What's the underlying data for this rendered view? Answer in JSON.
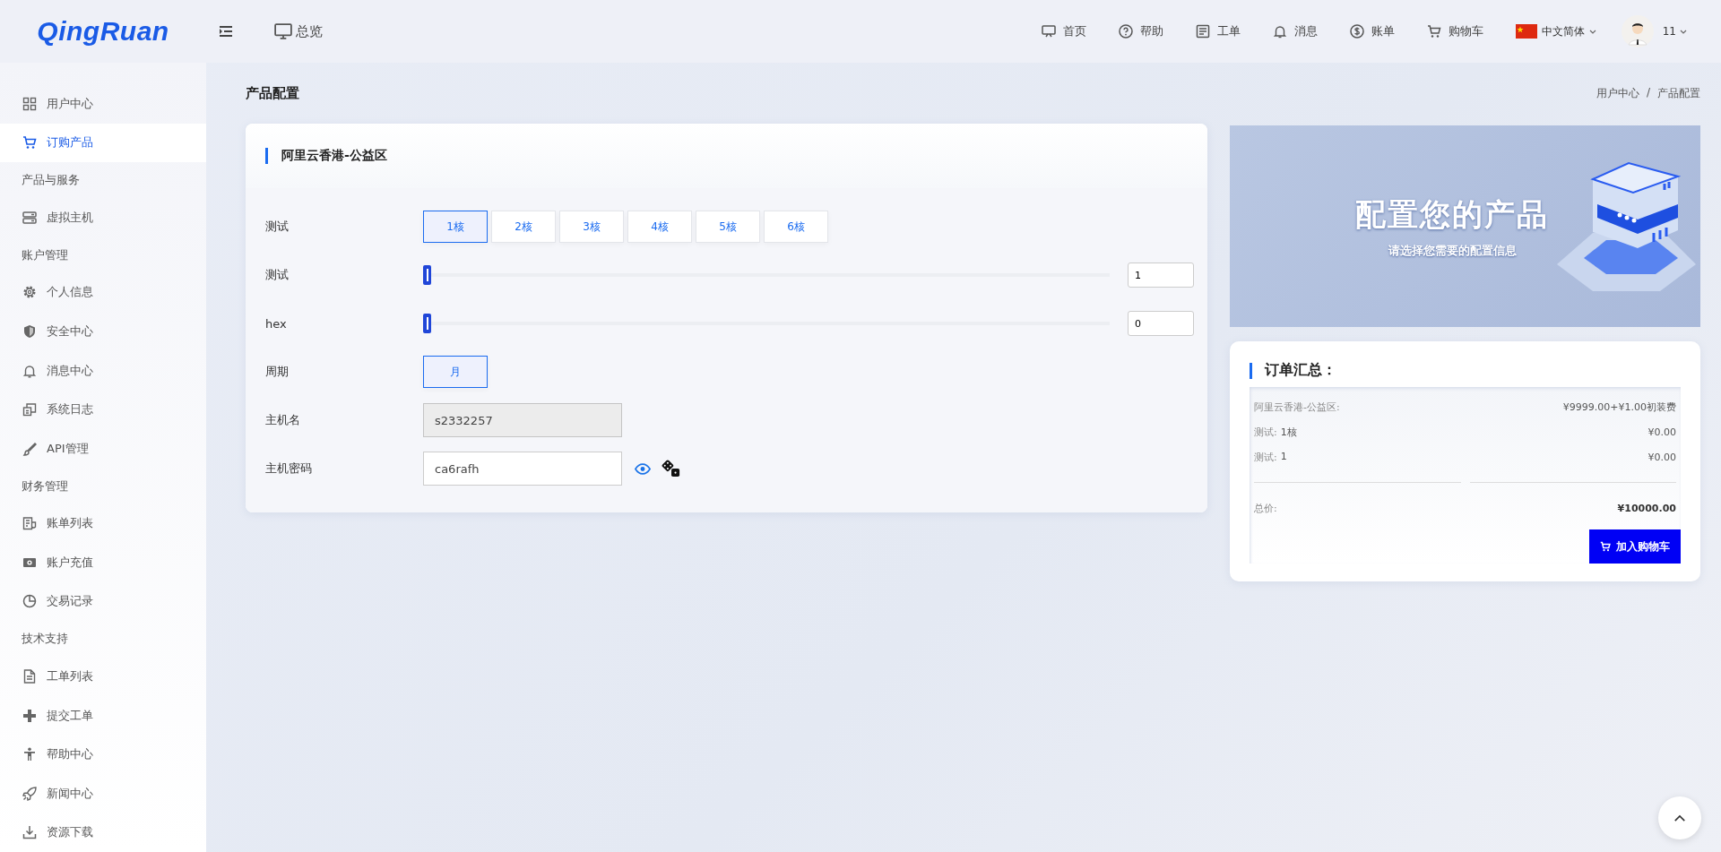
{
  "logo": "QingRuan",
  "header": {
    "overview": "总览",
    "nav": [
      {
        "label": "首页"
      },
      {
        "label": "帮助"
      },
      {
        "label": "工单"
      },
      {
        "label": "消息"
      },
      {
        "label": "账单"
      },
      {
        "label": "购物车"
      }
    ],
    "language": "中文简体",
    "user": "11"
  },
  "sidebar": {
    "items": [
      {
        "kind": "item",
        "label": "用户中心",
        "selected": false
      },
      {
        "kind": "item",
        "label": "订购产品",
        "selected": true
      },
      {
        "kind": "section",
        "label": "产品与服务"
      },
      {
        "kind": "item",
        "label": "虚拟主机",
        "selected": false
      },
      {
        "kind": "section",
        "label": "账户管理"
      },
      {
        "kind": "item",
        "label": "个人信息",
        "selected": false
      },
      {
        "kind": "item",
        "label": "安全中心",
        "selected": false
      },
      {
        "kind": "item",
        "label": "消息中心",
        "selected": false
      },
      {
        "kind": "item",
        "label": "系统日志",
        "selected": false
      },
      {
        "kind": "item",
        "label": "API管理",
        "selected": false
      },
      {
        "kind": "section",
        "label": "财务管理"
      },
      {
        "kind": "item",
        "label": "账单列表",
        "selected": false
      },
      {
        "kind": "item",
        "label": "账户充值",
        "selected": false
      },
      {
        "kind": "item",
        "label": "交易记录",
        "selected": false
      },
      {
        "kind": "section",
        "label": "技术支持"
      },
      {
        "kind": "item",
        "label": "工单列表",
        "selected": false
      },
      {
        "kind": "item",
        "label": "提交工单",
        "selected": false
      },
      {
        "kind": "item",
        "label": "帮助中心",
        "selected": false
      },
      {
        "kind": "item",
        "label": "新闻中心",
        "selected": false
      },
      {
        "kind": "item",
        "label": "资源下载",
        "selected": false
      }
    ]
  },
  "page": {
    "title": "产品配置",
    "breadcrumb": [
      "用户中心",
      "产品配置"
    ],
    "breadcrumb_separator": "/"
  },
  "product_card": {
    "title": "阿里云香港-公益区",
    "rows": [
      {
        "kind": "options",
        "label": "测试",
        "options": [
          {
            "label": "1核",
            "selected": true
          },
          {
            "label": "2核",
            "selected": false
          },
          {
            "label": "3核",
            "selected": false
          },
          {
            "label": "4核",
            "selected": false
          },
          {
            "label": "5核",
            "selected": false
          },
          {
            "label": "6核",
            "selected": false
          }
        ]
      },
      {
        "kind": "slider",
        "label": "测试",
        "level": 0,
        "value": "1"
      },
      {
        "kind": "slider",
        "label": "hex",
        "level": 0,
        "value": "0"
      },
      {
        "kind": "options",
        "label": "周期",
        "options": [
          {
            "label": "月",
            "selected": true
          }
        ]
      },
      {
        "kind": "text",
        "label": "主机名",
        "value": "s2332257",
        "disabled": true
      },
      {
        "kind": "password",
        "label": "主机密码",
        "value": "ca6rafh",
        "disabled": false
      }
    ]
  },
  "hero": {
    "title": "配置您的产品",
    "subtitle": "请选择您需要的配置信息"
  },
  "order_summary": {
    "title": "订单汇总：",
    "lines": [
      {
        "label": "阿里云香港-公益区:",
        "price": "¥9999.00+¥1.00初装费"
      },
      {
        "label": "测试:",
        "detail": "1核",
        "price": "¥0.00"
      },
      {
        "label": "测试:",
        "detail": "1",
        "price": "¥0.00"
      }
    ],
    "total_label": "总价:",
    "total": "¥10000.00",
    "button": "加入购物车"
  }
}
